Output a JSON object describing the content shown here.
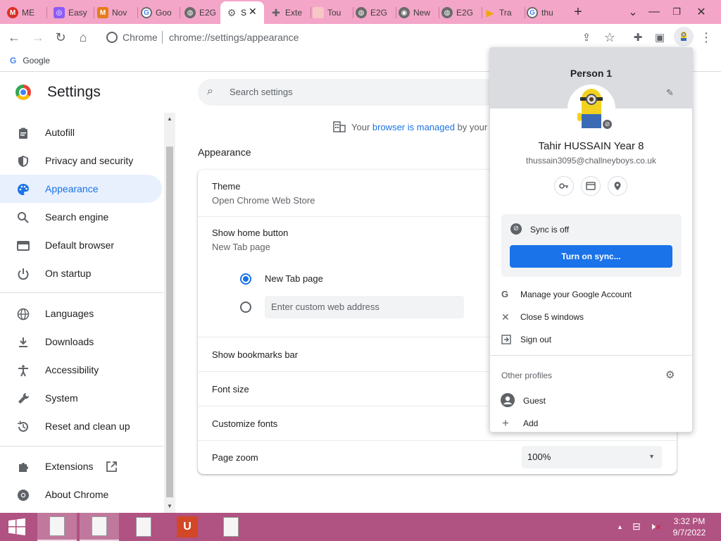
{
  "tabs": [
    {
      "label": "ME",
      "icon": "gmail-icon",
      "color": "#d93025"
    },
    {
      "label": "Easy",
      "icon": "app-icon",
      "color": "#8b5cf6"
    },
    {
      "label": "Nov",
      "icon": "colorful-icon",
      "color": "#e67c1a"
    },
    {
      "label": "Goo",
      "icon": "google-icon",
      "color": "#4285f4"
    },
    {
      "label": "E2G",
      "icon": "globe-icon",
      "color": "#6b6b6b"
    },
    {
      "label": "S",
      "icon": "gear-icon",
      "color": "#5f6368"
    },
    {
      "label": "Exte",
      "icon": "puzzle-icon",
      "color": "#6b6b6b"
    },
    {
      "label": "Tou",
      "icon": "image-icon",
      "color": "#c44"
    },
    {
      "label": "E2G",
      "icon": "globe-icon",
      "color": "#6b6b6b"
    },
    {
      "label": "New",
      "icon": "chrome-icon",
      "color": "#6b6b6b"
    },
    {
      "label": "E2G",
      "icon": "globe-icon",
      "color": "#6b6b6b"
    },
    {
      "label": "Tra",
      "icon": "play-icon",
      "color": "#f2a600"
    },
    {
      "label": "thu",
      "icon": "google-icon",
      "color": "#4285f4"
    }
  ],
  "toolbar": {
    "scheme": "Chrome",
    "url": "chrome://settings/appearance"
  },
  "bookmarks": {
    "items": [
      {
        "label": "Google"
      }
    ]
  },
  "settings": {
    "title": "Settings",
    "search_placeholder": "Search settings",
    "managed_prefix": "Your ",
    "managed_link": "browser is managed",
    "managed_suffix": " by your",
    "sidebar": [
      {
        "label": "Autofill",
        "icon": "clipboard-icon"
      },
      {
        "label": "Privacy and security",
        "icon": "shield-icon"
      },
      {
        "label": "Appearance",
        "icon": "palette-icon",
        "selected": true
      },
      {
        "label": "Search engine",
        "icon": "search-icon"
      },
      {
        "label": "Default browser",
        "icon": "browser-icon"
      },
      {
        "label": "On startup",
        "icon": "power-icon"
      },
      {
        "label": "Languages",
        "icon": "globe-icon"
      },
      {
        "label": "Downloads",
        "icon": "download-icon"
      },
      {
        "label": "Accessibility",
        "icon": "accessibility-icon"
      },
      {
        "label": "System",
        "icon": "wrench-icon"
      },
      {
        "label": "Reset and clean up",
        "icon": "restore-icon"
      },
      {
        "label": "Extensions",
        "icon": "puzzle-icon"
      },
      {
        "label": "About Chrome",
        "icon": "chrome-icon"
      }
    ],
    "section_title": "Appearance",
    "theme": {
      "title": "Theme",
      "subtitle": "Open Chrome Web Store"
    },
    "home_button": {
      "title": "Show home button",
      "subtitle": "New Tab page",
      "option_newtab": "New Tab page",
      "custom_placeholder": "Enter custom web address"
    },
    "bookmarks_bar": "Show bookmarks bar",
    "font_size": "Font size",
    "customize_fonts": "Customize fonts",
    "page_zoom": {
      "title": "Page zoom",
      "value": "100%"
    }
  },
  "profile": {
    "header": "Person 1",
    "name": "Tahir HUSSAIN Year 8",
    "email": "thussain3095@challneyboys.co.uk",
    "sync_status": "Sync is off",
    "sync_button": "Turn on sync...",
    "menu": [
      {
        "label": "Manage your Google Account",
        "icon": "google-icon"
      },
      {
        "label": "Close 5 windows",
        "icon": "close-icon"
      },
      {
        "label": "Sign out",
        "icon": "signout-icon"
      }
    ],
    "other_profiles_label": "Other profiles",
    "others": [
      {
        "label": "Guest",
        "icon": "person-icon"
      },
      {
        "label": "Add",
        "icon": "plus-icon"
      }
    ]
  },
  "taskbar": {
    "time": "3:32 PM",
    "date": "9/7/2022"
  },
  "colors": {
    "tabstrip": "#f4a6c8",
    "accent": "#1a73e8",
    "taskbar": "#b05282"
  }
}
